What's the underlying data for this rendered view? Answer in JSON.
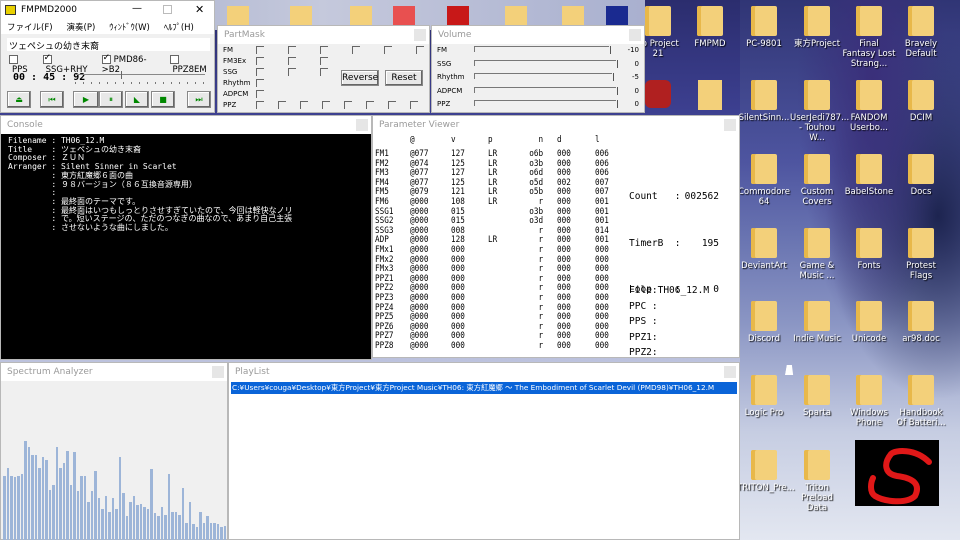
{
  "main_window": {
    "title": "FMPMD2000",
    "menu": [
      "ファイル(F)",
      "演奏(P)",
      "ｳｨﾝﾄﾞｳ(W)",
      "ﾍﾙﾌﾟ(H)"
    ],
    "song_title": "ツェペシュの幼き末裔",
    "options": [
      {
        "label": "PPS",
        "checked": false
      },
      {
        "label": "SSG+RHY",
        "checked": true
      },
      {
        "label": "PMD86->B2",
        "checked": true
      },
      {
        "label": "PPZ8EM",
        "checked": false
      }
    ],
    "time": "00 : 45 : 92",
    "seek_fraction": 0.33,
    "buttons": [
      "eject",
      "prev",
      "play",
      "pause",
      "slow",
      "stop",
      "next"
    ],
    "button_glyphs": [
      "⏏",
      "⏮",
      "▶",
      "⏸",
      "◣",
      "■",
      "⏭"
    ]
  },
  "partmask": {
    "title": "PartMask",
    "rows": [
      {
        "label": "FM",
        "count": 6
      },
      {
        "label": "FM3Ex",
        "count": 3
      },
      {
        "label": "SSG",
        "count": 3
      },
      {
        "label": "Rhythm",
        "count": 1
      },
      {
        "label": "ADPCM",
        "count": 1
      },
      {
        "label": "PPZ",
        "count": 8
      }
    ],
    "reverse_label": "Reverse",
    "reset_label": "Reset"
  },
  "volume": {
    "title": "Volume",
    "rows": [
      {
        "label": "FM",
        "value": "-10",
        "level": 0.95
      },
      {
        "label": "SSG",
        "value": "0",
        "level": 1
      },
      {
        "label": "Rhythm",
        "value": "-5",
        "level": 0.97
      },
      {
        "label": "ADPCM",
        "value": "0",
        "level": 1
      },
      {
        "label": "PPZ",
        "value": "0",
        "level": 1
      }
    ]
  },
  "console": {
    "title": "Console",
    "lines": [
      "Filename : TH06_12.M",
      "Title    : ツェペシュの幼き末裔",
      "Composer : ＺＵＮ",
      "Arranger : Silent Sinner in Scarlet",
      "         : 東方紅魔郷６面の曲",
      "         : ９８バージョン（８６互換音源専用）",
      "         :",
      "         : 最終面のテーマです。",
      "         : 最終面はいつもしっとりさせすぎていたので、今回は軽快なノリ",
      "         : で。短いステージの、ただのつなぎの曲なので、あまり自己主張",
      "         : させないような曲にしました。"
    ]
  },
  "params": {
    "title": "Parameter Viewer",
    "headers": [
      "",
      "@",
      "v",
      "p",
      "n",
      "d",
      "l"
    ],
    "rows": [
      [
        "FM1",
        "@077",
        "127",
        "LR",
        "o6b",
        "000",
        "006"
      ],
      [
        "FM2",
        "@074",
        "125",
        "LR",
        "o3b",
        "000",
        "006"
      ],
      [
        "FM3",
        "@077",
        "127",
        "LR",
        "o6d",
        "000",
        "006"
      ],
      [
        "FM4",
        "@077",
        "125",
        "LR",
        "o5d",
        "002",
        "007"
      ],
      [
        "FM5",
        "@079",
        "121",
        "LR",
        "o5b",
        "000",
        "007"
      ],
      [
        "FM6",
        "@000",
        "108",
        "LR",
        "r",
        "000",
        "001"
      ],
      [
        "SSG1",
        "@000",
        "015",
        "",
        "o3b",
        "000",
        "001"
      ],
      [
        "SSG2",
        "@000",
        "015",
        "",
        "o3d",
        "000",
        "001"
      ],
      [
        "SSG3",
        "@000",
        "008",
        "",
        "r",
        "000",
        "014"
      ],
      [
        "ADP",
        "@000",
        "128",
        "LR",
        "r",
        "000",
        "001"
      ],
      [
        "FMx1",
        "@000",
        "000",
        "",
        "r",
        "000",
        "000"
      ],
      [
        "FMx2",
        "@000",
        "000",
        "",
        "r",
        "000",
        "000"
      ],
      [
        "FMx3",
        "@000",
        "000",
        "",
        "r",
        "000",
        "000"
      ],
      [
        "PPZ1",
        "@000",
        "000",
        "",
        "r",
        "000",
        "000"
      ],
      [
        "PPZ2",
        "@000",
        "000",
        "",
        "r",
        "000",
        "000"
      ],
      [
        "PPZ3",
        "@000",
        "000",
        "",
        "r",
        "000",
        "000"
      ],
      [
        "PPZ4",
        "@000",
        "000",
        "",
        "r",
        "000",
        "000"
      ],
      [
        "PPZ5",
        "@000",
        "000",
        "",
        "r",
        "000",
        "000"
      ],
      [
        "PPZ6",
        "@000",
        "000",
        "",
        "r",
        "000",
        "000"
      ],
      [
        "PPZ7",
        "@000",
        "000",
        "",
        "r",
        "000",
        "000"
      ],
      [
        "PPZ8",
        "@000",
        "000",
        "",
        "r",
        "000",
        "000"
      ]
    ],
    "count_label": "Count   :",
    "count": "002562",
    "timerb_label": "TimerB  :",
    "timerb": "195",
    "loop_label": "Loop    :",
    "loop": "0",
    "file": "File:TH06_12.M",
    "ppc": "PPC :",
    "pps": "PPS :",
    "ppz1": "PPZ1:",
    "ppz2": "PPZ2:"
  },
  "spectrum": {
    "title": "Spectrum Analyzer",
    "levels": [
      41,
      46,
      41,
      40,
      41,
      42,
      63,
      59,
      54,
      54,
      46,
      53,
      51,
      32,
      35,
      59,
      46,
      49,
      57,
      35,
      56,
      31,
      41,
      41,
      24,
      31,
      44,
      27,
      20,
      28,
      18,
      27,
      20,
      53,
      30,
      15,
      24,
      28,
      22,
      23,
      21,
      20,
      45,
      17,
      15,
      21,
      16,
      42,
      18,
      18,
      16,
      33,
      11,
      24,
      10,
      8,
      18,
      11,
      15,
      11,
      11,
      10,
      8,
      9
    ],
    "bar_color": "#9db5d8"
  },
  "playlist": {
    "title": "PlayList",
    "items": [
      "C:¥Users¥couga¥Desktop¥東方Project¥東方Project Music¥TH06: 東方紅魔郷 ～ The Embodiment of Scarlet Devil (PMD98)¥TH06_12.M"
    ],
    "selected": 0
  },
  "desktop": {
    "icons": [
      "ko Project 21",
      "FMPMD",
      "PC-9801",
      "東方Project",
      "Final Fantasy Lost Strang...",
      "Bravely Default",
      "SilentSinn...",
      "UserJedi787... - Touhou W...",
      "FANDOM Userbo...",
      "DCIM",
      "Commodore 64",
      "Custom Covers",
      "BabelStone",
      "Docs",
      "DeviantArt",
      "Game & Music ...",
      "Fonts",
      "Protest Flags",
      "Discord",
      "Indie Music",
      "Unicode",
      "ar98.doc",
      "Logic Pro",
      "Sparta",
      "Windows Phone",
      "Handbook Of Batteri...",
      "TRITON_Pre...",
      "Triton Preload Data"
    ]
  }
}
